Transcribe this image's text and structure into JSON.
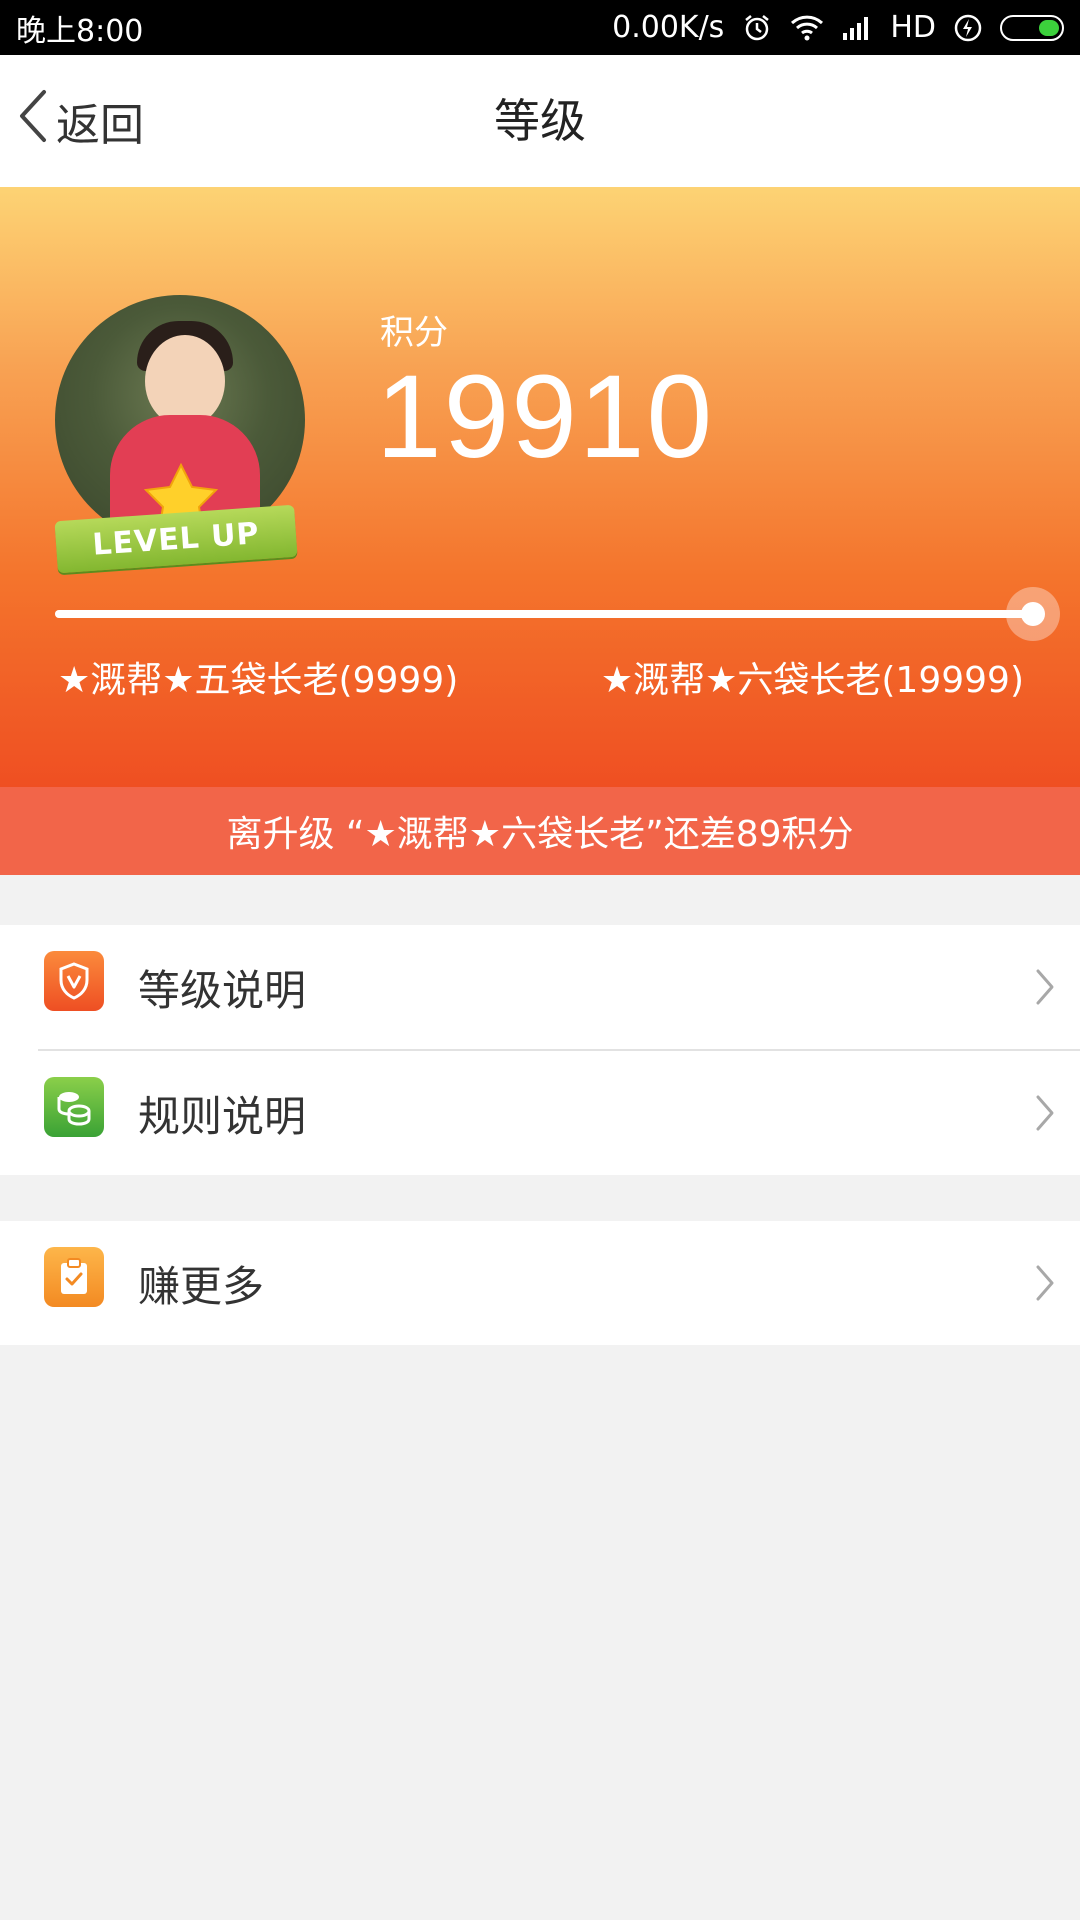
{
  "status_bar": {
    "time": "晚上8:00",
    "net_speed": "0.00K/s",
    "network_type": "HD"
  },
  "nav": {
    "back_label": "返回",
    "title": "等级"
  },
  "hero": {
    "score_label": "积分",
    "score_value": "19910",
    "badge_text": "LEVEL UP",
    "current_level": "★溉帮★五袋长老(9999)",
    "next_level": "★溉帮★六袋长老(19999)",
    "progress_fraction": 0.99,
    "colors": {
      "gradient_top": "#fdd374",
      "gradient_bottom": "#ef4f22"
    }
  },
  "upgrade_hint": "离升级 “★溉帮★六袋长老”还差89积分",
  "menu": {
    "group1": [
      {
        "label": "等级说明",
        "icon": "shield-v-icon"
      },
      {
        "label": "规则说明",
        "icon": "coins-icon"
      }
    ],
    "group2": [
      {
        "label": "赚更多",
        "icon": "clipboard-check-icon"
      }
    ]
  }
}
